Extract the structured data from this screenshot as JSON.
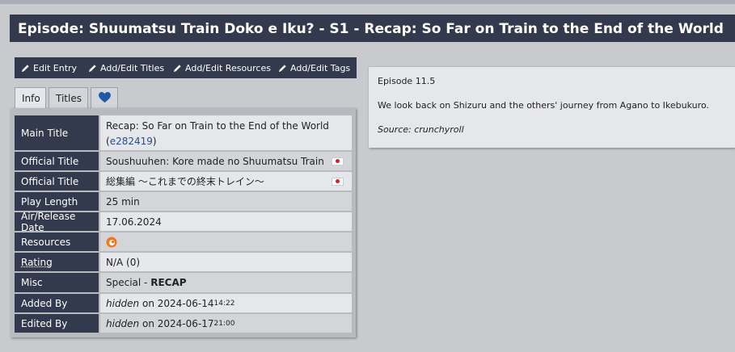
{
  "page_title": "Episode: Shuumatsu Train Doko e Iku? - S1 - Recap: So Far on Train to the End of the World",
  "buttons": {
    "edit_entry": "Edit Entry",
    "edit_titles": "Add/Edit Titles",
    "edit_resources": "Add/Edit Resources",
    "edit_tags": "Add/Edit Tags"
  },
  "tabs": {
    "info": "Info",
    "titles": "Titles",
    "favorite_icon": "heart-icon"
  },
  "info": {
    "main_title": {
      "label": "Main Title",
      "value": "Recap: So Far on Train to the End of the World",
      "id_open": "(",
      "id": "e282419",
      "id_close": ")"
    },
    "official_title_1": {
      "label": "Official Title",
      "value": "Soushuuhen: Kore made no Shuumatsu Train"
    },
    "official_title_2": {
      "label": "Official Title",
      "value": "総集編 ～これまでの終末トレイン～"
    },
    "play_length": {
      "label": "Play Length",
      "value": "25 min"
    },
    "air_date": {
      "label": "Air/Release Date",
      "value": "17.06.2024"
    },
    "resources": {
      "label": "Resources",
      "icon": "crunchyroll-icon"
    },
    "rating": {
      "label": "Rating",
      "value": "N/A (0)"
    },
    "misc": {
      "label": "Misc",
      "value": "Special - ",
      "value_bold": "RECAP"
    },
    "added_by": {
      "label": "Added By",
      "user": "hidden",
      "on": " on ",
      "date": "2024-06-14",
      "time": "14:22"
    },
    "edited_by": {
      "label": "Edited By",
      "user": "hidden",
      "on": " on ",
      "date": "2024-06-17",
      "time": "21:00"
    }
  },
  "description": {
    "episode": "Episode 11.5",
    "text": "We look back on Shizuru and the others' journey from Agano to Ikebukuro.",
    "source": "Source: crunchyroll"
  },
  "colors": {
    "header_bg": "#343a4e",
    "panel_bg": "#b7babf",
    "row_light": "#e6e7ea",
    "row_dark": "#d3d5d9",
    "heart": "#1e5aa8",
    "crunchyroll": "#f47521"
  }
}
